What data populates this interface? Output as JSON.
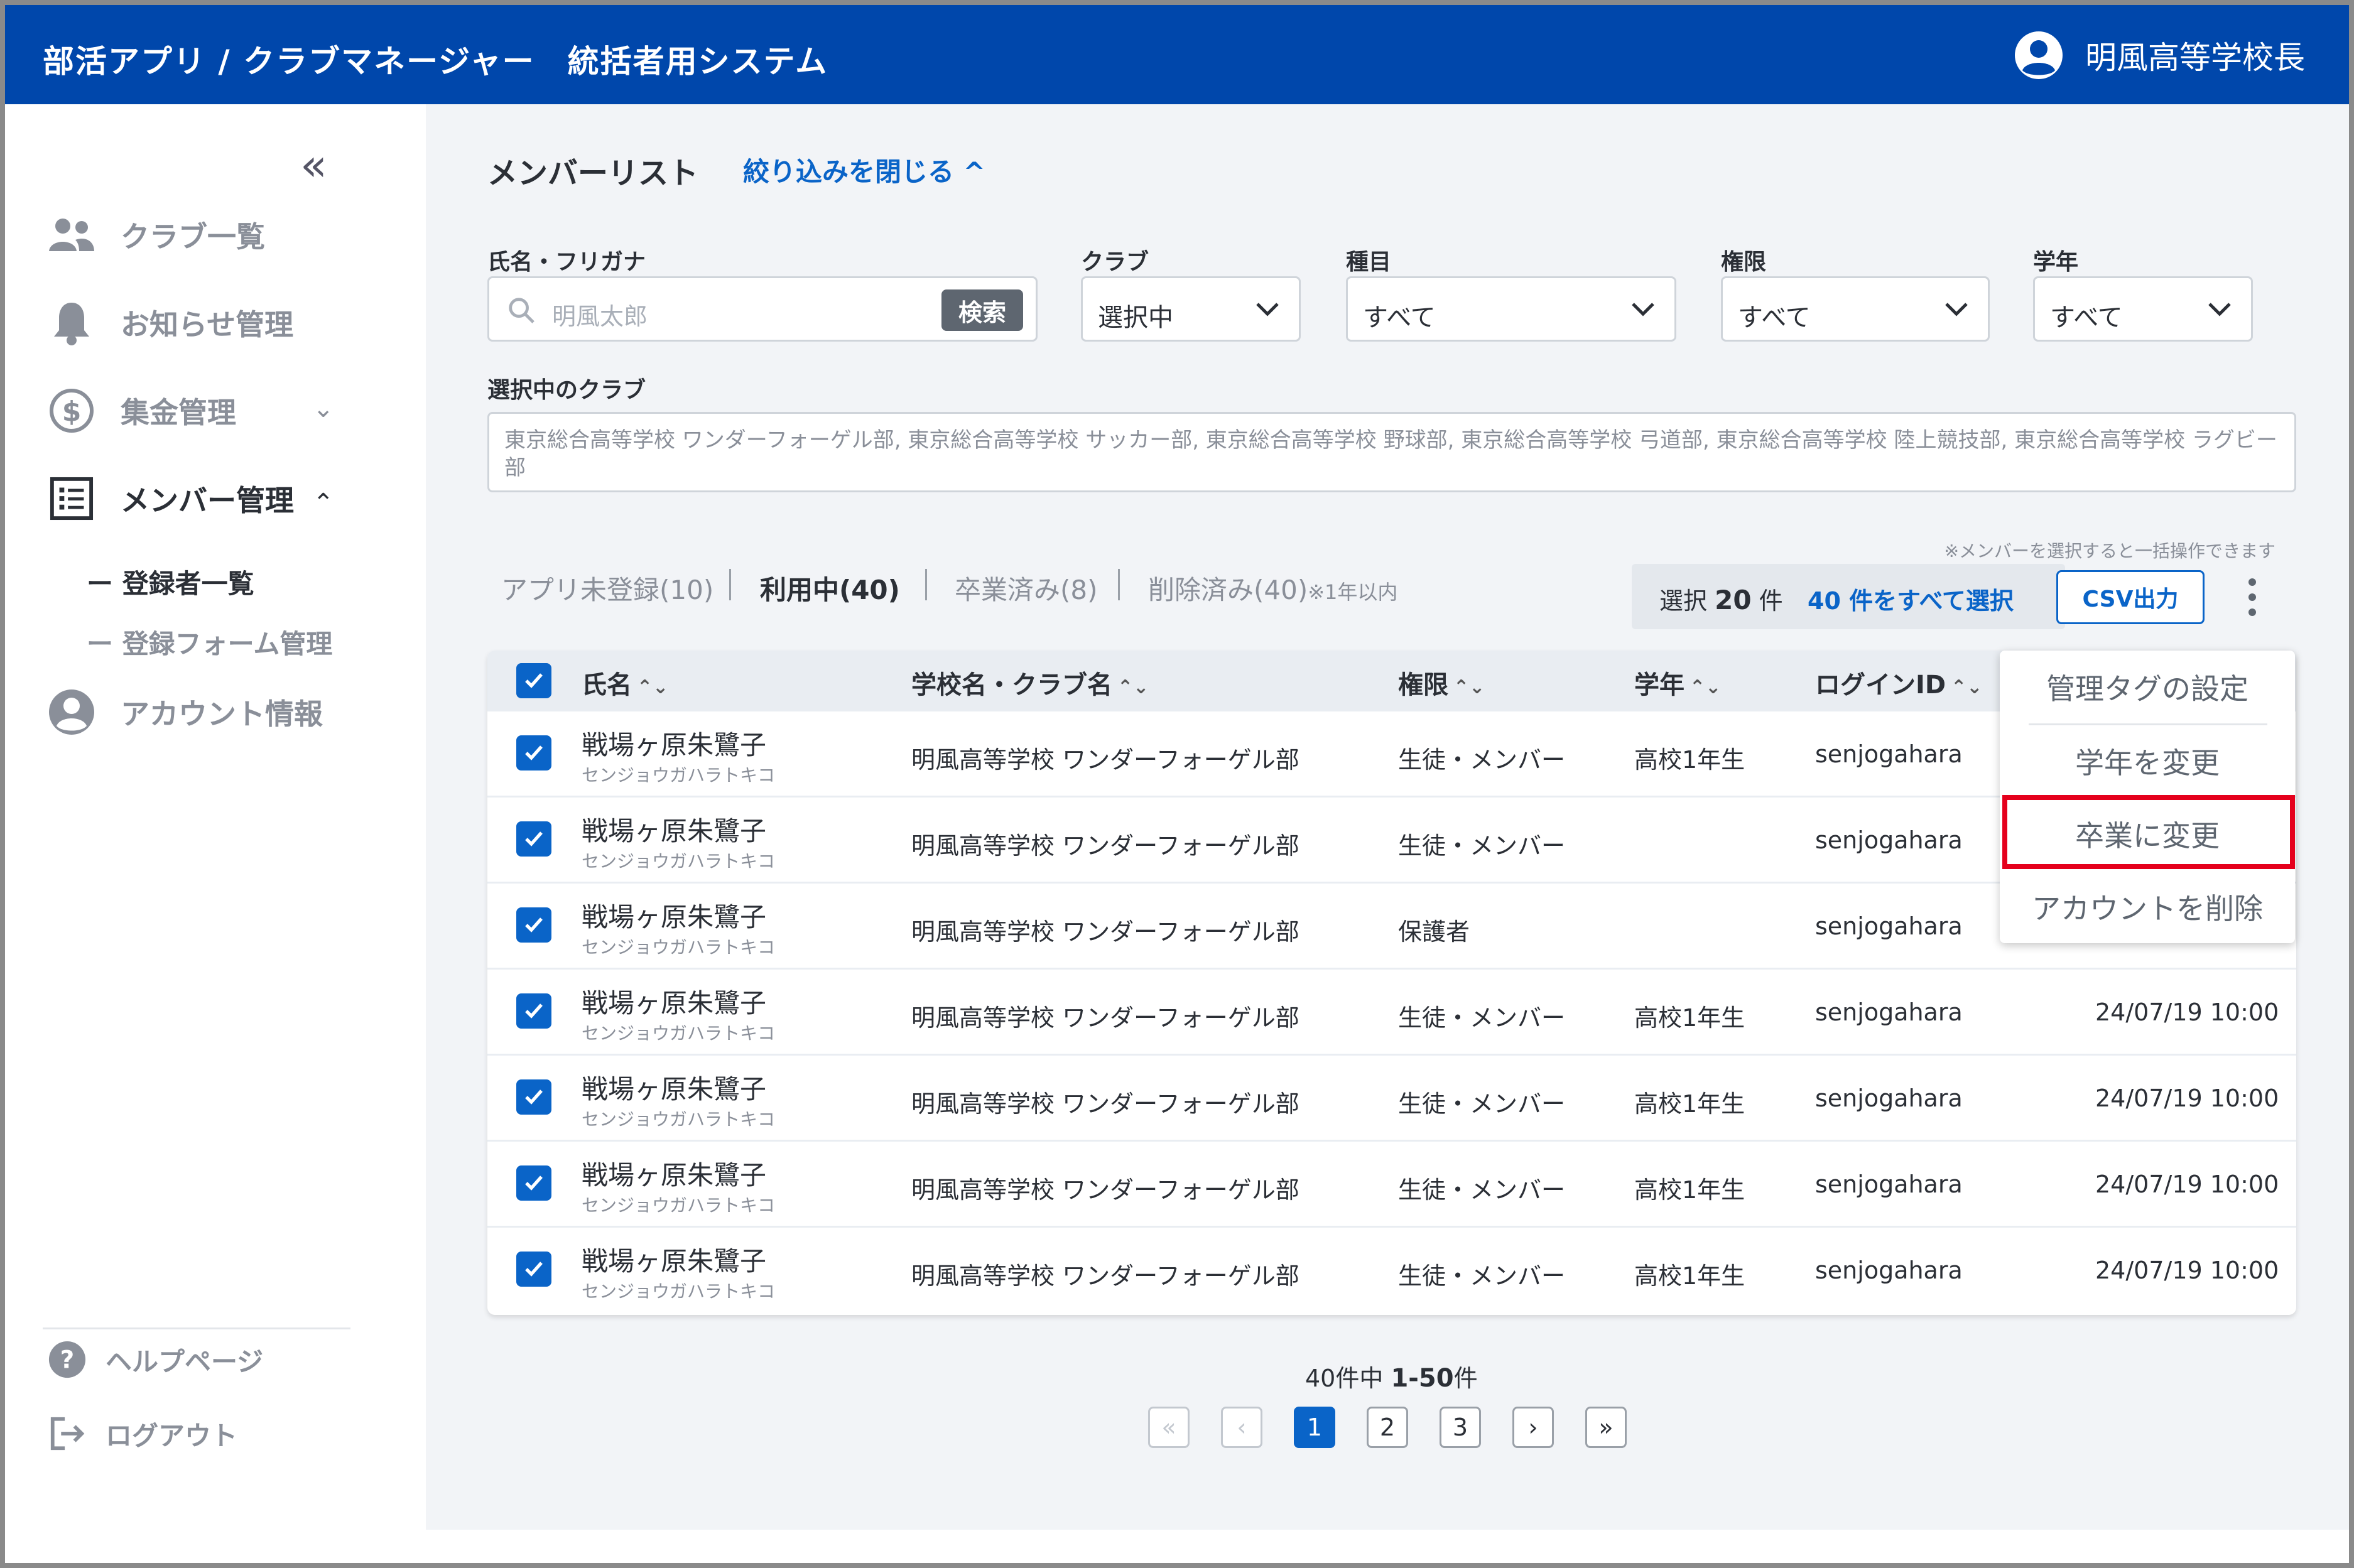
{
  "header": {
    "title": "部活アプリ / クラブマネージャー　統括者用システム",
    "user_name": "明風高等学校長"
  },
  "sidebar": {
    "collapse_label": "«",
    "items": [
      {
        "label": "クラブ一覧",
        "icon": "people-icon"
      },
      {
        "label": "お知らせ管理",
        "icon": "bell-icon"
      },
      {
        "label": "集金管理",
        "icon": "dollar-icon"
      },
      {
        "label": "メンバー管理",
        "icon": "list-icon"
      },
      {
        "label": "アカウント情報",
        "icon": "account-icon"
      }
    ],
    "sub_items": [
      "ー 登録者一覧",
      "ー 登録フォーム管理"
    ],
    "footer": [
      {
        "label": "ヘルプページ",
        "icon": "help-icon"
      },
      {
        "label": "ログアウト",
        "icon": "logout-icon"
      }
    ]
  },
  "main": {
    "title": "メンバーリスト",
    "filter_toggle": "絞り込みを閉じる ^",
    "filters": {
      "name_label": "氏名・フリガナ",
      "name_placeholder": "明風太郎",
      "search_button": "検索",
      "club_label": "クラブ",
      "club_value": "選択中",
      "type_label": "種目",
      "type_value": "すべて",
      "role_label": "権限",
      "role_value": "すべて",
      "grade_label": "学年",
      "grade_value": "すべて"
    },
    "selected_clubs_label": "選択中のクラブ",
    "selected_clubs": "東京総合高等学校 ワンダーフォーゲル部, 東京総合高等学校 サッカー部, 東京総合高等学校 野球部, 東京総合高等学校 弓道部, 東京総合高等学校 陸上競技部, 東京総合高等学校 ラグビー部",
    "bulk_note": "※メンバーを選択すると一括操作できます",
    "tabs": [
      {
        "label": "アプリ未登録(10)"
      },
      {
        "label": "利用中(40)"
      },
      {
        "label": "卒業済み(8)"
      },
      {
        "label": "削除済み(40)",
        "note": "※1年以内"
      }
    ],
    "selection": {
      "prefix": "選択",
      "count": "20",
      "suffix": "件",
      "select_all": "40 件をすべて選択"
    },
    "csv_button": "CSV出力",
    "table": {
      "columns": [
        "氏名",
        "学校名・クラブ名",
        "権限",
        "学年",
        "ログインID"
      ],
      "sort_symbol": "⌃⌄",
      "rows": [
        {
          "name": "戦場ヶ原朱鷺子",
          "kana": "センジョウガハラトキコ",
          "club": "明風高等学校 ワンダーフォーゲル部",
          "role": "生徒・メンバー",
          "grade": "高校1年生",
          "login": "senjogahara",
          "date": ""
        },
        {
          "name": "戦場ヶ原朱鷺子",
          "kana": "センジョウガハラトキコ",
          "club": "明風高等学校 ワンダーフォーゲル部",
          "role": "生徒・メンバー",
          "grade": "",
          "login": "senjogahara",
          "date": ""
        },
        {
          "name": "戦場ヶ原朱鷺子",
          "kana": "センジョウガハラトキコ",
          "club": "明風高等学校 ワンダーフォーゲル部",
          "role": "保護者",
          "grade": "",
          "login": "senjogahara",
          "date": ""
        },
        {
          "name": "戦場ヶ原朱鷺子",
          "kana": "センジョウガハラトキコ",
          "club": "明風高等学校 ワンダーフォーゲル部",
          "role": "生徒・メンバー",
          "grade": "高校1年生",
          "login": "senjogahara",
          "date": "24/07/19 10:00"
        },
        {
          "name": "戦場ヶ原朱鷺子",
          "kana": "センジョウガハラトキコ",
          "club": "明風高等学校 ワンダーフォーゲル部",
          "role": "生徒・メンバー",
          "grade": "高校1年生",
          "login": "senjogahara",
          "date": "24/07/19 10:00"
        },
        {
          "name": "戦場ヶ原朱鷺子",
          "kana": "センジョウガハラトキコ",
          "club": "明風高等学校 ワンダーフォーゲル部",
          "role": "生徒・メンバー",
          "grade": "高校1年生",
          "login": "senjogahara",
          "date": "24/07/19 10:00"
        },
        {
          "name": "戦場ヶ原朱鷺子",
          "kana": "センジョウガハラトキコ",
          "club": "明風高等学校 ワンダーフォーゲル部",
          "role": "生徒・メンバー",
          "grade": "高校1年生",
          "login": "senjogahara",
          "date": "24/07/19 10:00"
        }
      ]
    },
    "dropdown_menu": [
      "管理タグの設定",
      "学年を変更",
      "卒業に変更",
      "アカウントを削除"
    ],
    "pagination": {
      "total_prefix": "40件中",
      "range": "1-50",
      "range_suffix": "件",
      "pages": [
        "1",
        "2",
        "3"
      ],
      "current": "1",
      "first": "«",
      "prev": "‹",
      "next": "›",
      "last": "»"
    }
  },
  "colors": {
    "header_bg": "#0047ab",
    "accent": "#0a64c8",
    "highlight": "#e5001c",
    "content_bg": "#f2f4f7"
  }
}
